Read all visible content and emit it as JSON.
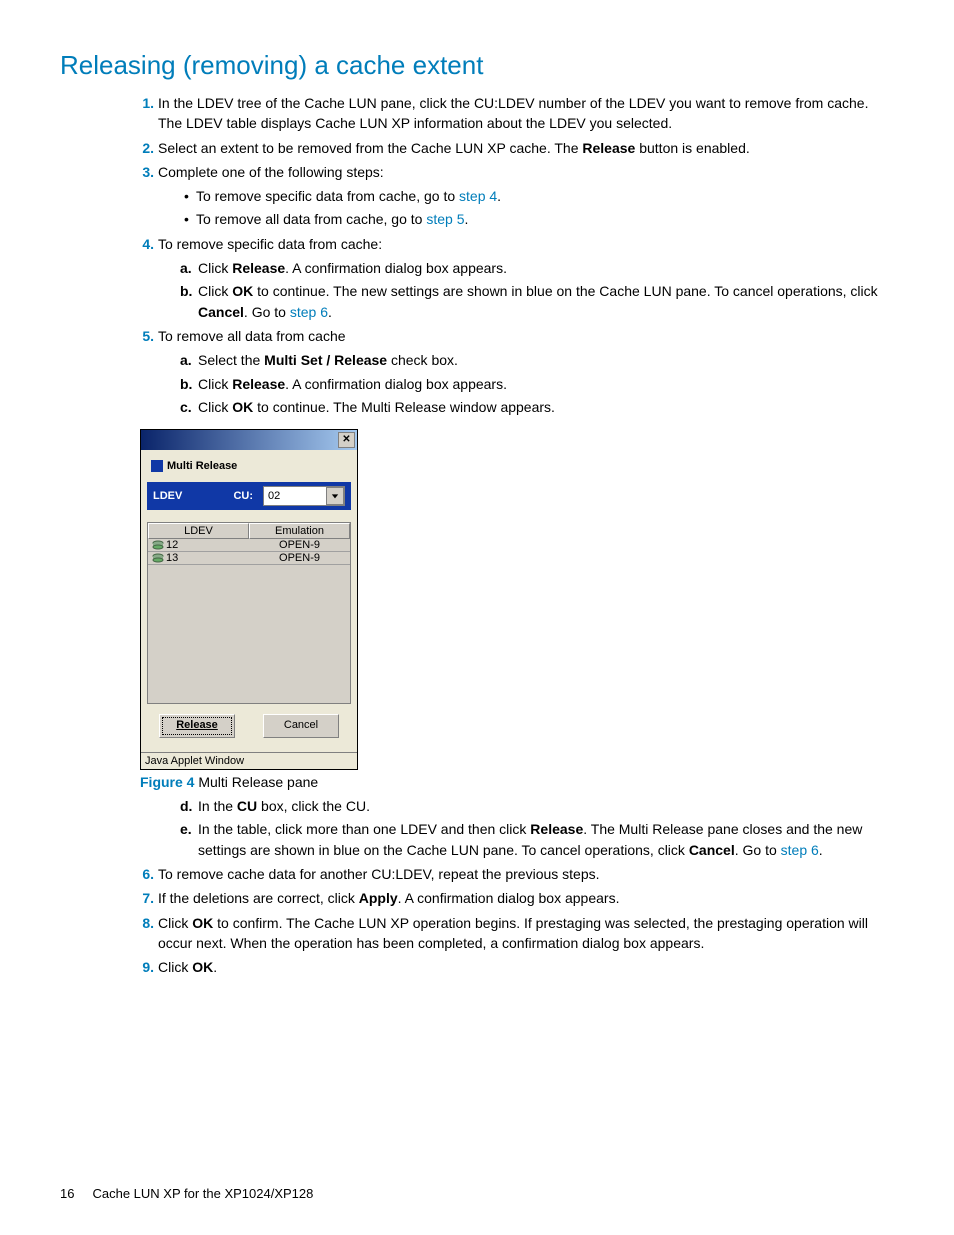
{
  "title": "Releasing (removing) a cache extent",
  "steps": {
    "s1": "In the LDEV tree of the Cache LUN pane, click the CU:LDEV number of the LDEV you want to remove from cache. The LDEV table displays Cache LUN XP information about the LDEV you selected.",
    "s2_a": "Select an extent to be removed from the Cache LUN XP cache. The ",
    "s2_b": "Release",
    "s2_c": " button is enabled.",
    "s3": "Complete one of the following steps:",
    "s3_b1_a": "To remove specific data from cache, go to ",
    "s3_b1_link": "step 4",
    "s3_b2_a": "To remove all data from cache, go to ",
    "s3_b2_link": "step 5",
    "s4": "To remove specific data from cache:",
    "s4a_a": "Click ",
    "s4a_b": "Release",
    "s4a_c": ". A confirmation dialog box appears.",
    "s4b_a": "Click ",
    "s4b_b": "OK",
    "s4b_c": " to continue. The new settings are shown in blue on the Cache LUN pane. To cancel operations, click ",
    "s4b_d": "Cancel",
    "s4b_e": ". Go to ",
    "s4b_link": "step 6",
    "s5": "To remove all data from cache",
    "s5a_a": "Select the ",
    "s5a_b": "Multi Set / Release",
    "s5a_c": " check box.",
    "s5b_a": "Click ",
    "s5b_b": "Release",
    "s5b_c": ". A confirmation dialog box appears.",
    "s5c_a": "Click ",
    "s5c_b": "OK",
    "s5c_c": " to continue. The Multi Release window appears.",
    "s5d_a": "In the ",
    "s5d_b": "CU",
    "s5d_c": " box, click the CU.",
    "s5e_a": "In the table, click more than one LDEV and then click ",
    "s5e_b": "Release",
    "s5e_c": ". The Multi Release pane closes and the new settings are shown in blue on the Cache LUN pane. To cancel operations, click ",
    "s5e_d": "Cancel",
    "s5e_e": ". Go to ",
    "s5e_link": "step 6",
    "s6": "To remove cache data for another CU:LDEV, repeat the previous steps.",
    "s7_a": "If the deletions are correct, click ",
    "s7_b": "Apply",
    "s7_c": ". A confirmation dialog box appears.",
    "s8_a": "Click ",
    "s8_b": "OK",
    "s8_c": " to confirm. The Cache LUN XP operation begins. If prestaging was selected, the prestaging operation will occur next. When the operation has been completed, a confirmation dialog box appears.",
    "s9_a": "Click ",
    "s9_b": "OK",
    "s9_c": "."
  },
  "dialog": {
    "title": "Multi Release",
    "ldev_label": "LDEV",
    "cu_label": "CU:",
    "cu_value": "02",
    "col_ldev": "LDEV",
    "col_emu": "Emulation",
    "rows": [
      {
        "ldev": "12",
        "emu": "OPEN-9"
      },
      {
        "ldev": "13",
        "emu": "OPEN-9"
      }
    ],
    "release_btn": "Release",
    "cancel_btn": "Cancel",
    "java_footer": "Java Applet Window"
  },
  "figure": {
    "label": "Figure 4",
    "text": " Multi Release pane"
  },
  "footer": {
    "pagenum": "16",
    "doc": "Cache LUN XP for the XP1024/XP128"
  }
}
